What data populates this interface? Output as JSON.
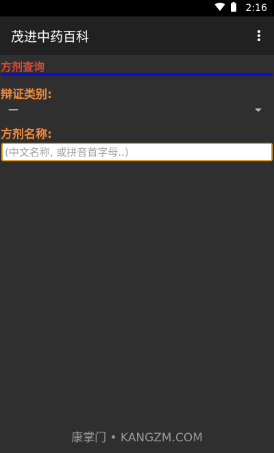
{
  "status_bar": {
    "time": "2:16",
    "icons": [
      "wifi-icon",
      "battery-icon"
    ]
  },
  "app_bar": {
    "title": "茂进中药百科",
    "menu_icon": "more-vert-icon"
  },
  "section": {
    "title": "方剂查询",
    "rule_color": "#1010c8"
  },
  "form": {
    "category_label": "辩证类别:",
    "category_value": "—",
    "name_label": "方剂名称:",
    "name_placeholder": "(中文名称, 或拼音首字母..)",
    "name_value": ""
  },
  "footer": {
    "text": "康掌门 • KANGZM.COM"
  },
  "colors": {
    "background": "#2f2f2f",
    "app_bar": "#212121",
    "section_title": "#d84a3a",
    "label": "#f08a3e",
    "input_border": "#e0a030"
  }
}
